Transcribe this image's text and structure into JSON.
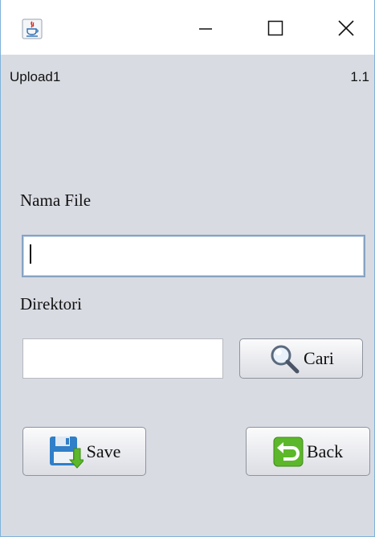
{
  "window": {
    "title": "",
    "controls": {
      "minimize": "minimize",
      "maximize": "maximize",
      "close": "close"
    }
  },
  "menu": {
    "left_label": "Upload1",
    "right_label": "1.1"
  },
  "form": {
    "nama_file_label": "Nama File",
    "nama_file_value": "",
    "direktori_label": "Direktori",
    "direktori_value": ""
  },
  "buttons": {
    "cari_label": "Cari",
    "save_label": "Save",
    "back_label": "Back"
  },
  "icons": {
    "app": "java-icon",
    "cari": "magnifier-icon",
    "save": "floppy-save-icon",
    "back": "back-arrow-icon"
  },
  "colors": {
    "window_bg": "#d9dbe3",
    "titlebar_bg": "#ffffff",
    "focus_border": "#86a3c3",
    "back_icon_green": "#5cb82a",
    "save_icon_blue": "#2f7fc9"
  }
}
